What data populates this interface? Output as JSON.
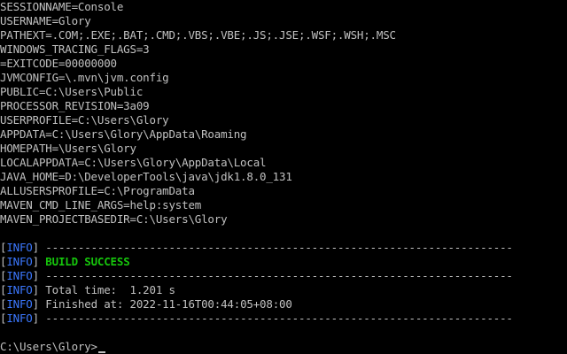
{
  "env_lines": [
    "SESSIONNAME=Console",
    "USERNAME=Glory",
    "PATHEXT=.COM;.EXE;.BAT;.CMD;.VBS;.VBE;.JS;.JSE;.WSF;.WSH;.MSC",
    "WINDOWS_TRACING_FLAGS=3",
    "=EXITCODE=00000000",
    "JVMCONFIG=\\.mvn\\jvm.config",
    "PUBLIC=C:\\Users\\Public",
    "PROCESSOR_REVISION=3a09",
    "USERPROFILE=C:\\Users\\Glory",
    "APPDATA=C:\\Users\\Glory\\AppData\\Roaming",
    "HOMEPATH=\\Users\\Glory",
    "LOCALAPPDATA=C:\\Users\\Glory\\AppData\\Local",
    "JAVA_HOME=D:\\DeveloperTools\\java\\jdk1.8.0_131",
    "ALLUSERSPROFILE=C:\\ProgramData",
    "MAVEN_CMD_LINE_ARGS=help:system",
    "MAVEN_PROJECTBASEDIR=C:\\Users\\Glory"
  ],
  "log": {
    "bracket_open": "[",
    "bracket_close": "]",
    "level": "INFO",
    "separator": " ------------------------------------------------------------------------",
    "build_success": " BUILD SUCCESS",
    "total_time": " Total time:  1.201 s",
    "finished_at": " Finished at: 2022-11-16T00:44:05+08:00"
  },
  "prompt": "C:\\Users\\Glory>",
  "colors": {
    "background": "#000000",
    "text": "#c0c0c0",
    "info_level": "#3b78ff",
    "success": "#16c60c"
  }
}
